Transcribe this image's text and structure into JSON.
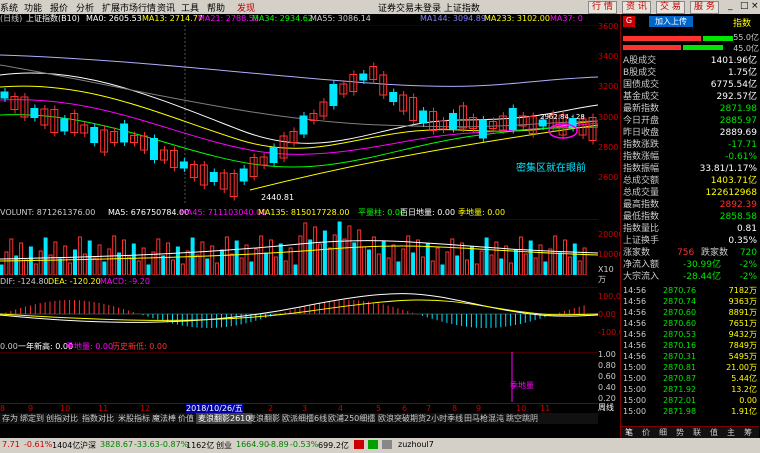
{
  "menu": {
    "items": [
      "系统",
      "功能",
      "报价",
      "分析",
      "扩展市场行情",
      "资讯",
      "工具",
      "帮助"
    ],
    "highlight": "发现",
    "center_title": "证券交易未登录 上证指数",
    "right_buttons": [
      "行 情",
      "资 讯",
      "交 易",
      "服 务"
    ]
  },
  "infobar": {
    "period": "(日线)",
    "index_code": "上证指数(B10)",
    "ma0": "MA0: 2605.53",
    "ma13": "MA13: 2714.77",
    "ma21": "MA21: 2788.53",
    "ma34": "MA34: 2934.62",
    "ma55": "MA55: 3086.14",
    "ma144": "MA144: 3094.89",
    "ma233": "MA233: 3102.00",
    "ma_tail": "MA37: 0"
  },
  "main_axis": [
    "3600",
    "3400",
    "3200",
    "3000",
    "2800",
    "2600"
  ],
  "annotations": {
    "low_value": "2440.81",
    "recent_value": "2962.84 - 28",
    "note": "密集区就在眼前"
  },
  "volume_bar": {
    "volume": "VOLUNT: 871261376.00",
    "ma5": "MA5: 676750784.00",
    "ma45": "MA45: 711103040.00",
    "ma135": "MA135: 815017728.00",
    "flat": "平量柱: 0.00",
    "hundred": "百日地量: 0.00",
    "season": "季地量: 0.00",
    "axis": [
      "20000",
      "10000",
      "X10万"
    ]
  },
  "macd": {
    "dif": "DIF: -124.80",
    "dea": "DEA: -120.20",
    "macd": "MACD: -9.20",
    "axis": [
      "100.0",
      "0.00",
      "-100.0"
    ]
  },
  "indicator": {
    "label1": "0.00",
    "label2": "一年新高: 0.00",
    "label3": "季地量: 0.00",
    "label4": "历史新低: 0.00",
    "axis": [
      "1.00",
      "0.80",
      "0.60",
      "0.40",
      "0.20"
    ],
    "marker": "季地量"
  },
  "xaxis": {
    "date_label": "2018/10/26/五",
    "months": [
      "8",
      "9",
      "10",
      "11",
      "12",
      "2",
      "3",
      "4",
      "5",
      "6",
      "7",
      "8",
      "9",
      "10",
      "11"
    ],
    "right_label": "周线"
  },
  "bottom_tabs": [
    "存为",
    "绑定到",
    "创指对比",
    "指数对比",
    "米股指标",
    "魔法棒",
    "价值",
    "麦浪翻影2610",
    "麦浪翻影",
    "欧派细擂6线",
    "欧浦250细擂",
    "欧浪突破",
    "期货2小时季线",
    "田马枪",
    "混沌",
    "跳空跳阴"
  ],
  "right_panel": {
    "header_label": "指数",
    "header_button": "加入上传",
    "top_values": [
      "55.0亿",
      "45.0亿"
    ],
    "rows": [
      {
        "k": "A股成交",
        "v": "1401.96亿",
        "c": "white"
      },
      {
        "k": "B股成交",
        "v": "1.75亿",
        "c": "white"
      },
      {
        "k": "国债成交",
        "v": "6775.54亿",
        "c": "white"
      },
      {
        "k": "基金成交",
        "v": "292.57亿",
        "c": "white"
      },
      {
        "k": "最新指数",
        "v": "2871.98",
        "c": "green"
      },
      {
        "k": "今日开盘",
        "v": "2885.97",
        "c": "green"
      },
      {
        "k": "昨日收盘",
        "v": "2889.69",
        "c": "white"
      },
      {
        "k": "指数涨跌",
        "v": "-17.71",
        "c": "green"
      },
      {
        "k": "指数涨幅",
        "v": "-0.61%",
        "c": "green"
      },
      {
        "k": "指数振幅",
        "v": "33.81/1.17%",
        "c": "white"
      },
      {
        "k": "总成交额",
        "v": "1403.71亿",
        "c": "yellow"
      },
      {
        "k": "总成交量",
        "v": "122612968",
        "c": "yellow"
      },
      {
        "k": "最高指数",
        "v": "2892.39",
        "c": "red"
      },
      {
        "k": "最低指数",
        "v": "2858.58",
        "c": "green"
      },
      {
        "k": "指数量比",
        "v": "0.81",
        "c": "white"
      },
      {
        "k": "上证换手",
        "v": "0.35%",
        "c": "white"
      }
    ],
    "up_label": "涨家数",
    "up_value": "756",
    "down_label": "跌家数",
    "down_value": "720",
    "inflow_label": "净流入额",
    "inflow_value": "-30.99亿",
    "inflow_pct": "-2%",
    "big_label": "大宗流入",
    "big_value": "-28.44亿",
    "big_pct": "-2%",
    "ticks": [
      {
        "t": "14:56",
        "p": "2870.76",
        "v": "7182万"
      },
      {
        "t": "14:56",
        "p": "2870.74",
        "v": "9363万"
      },
      {
        "t": "14:56",
        "p": "2870.60",
        "v": "8891万"
      },
      {
        "t": "14:56",
        "p": "2870.60",
        "v": "7651万"
      },
      {
        "t": "14:56",
        "p": "2870.53",
        "v": "9432万"
      },
      {
        "t": "14:56",
        "p": "2870.16",
        "v": "7849万"
      },
      {
        "t": "14:56",
        "p": "2870.31",
        "v": "5495万"
      },
      {
        "t": "15:00",
        "p": "2870.81",
        "v": "21.00万"
      },
      {
        "t": "15:00",
        "p": "2870.87",
        "v": "5.44亿"
      },
      {
        "t": "15:00",
        "p": "2871.92",
        "v": "13.2亿"
      },
      {
        "t": "15:00",
        "p": "2872.01",
        "v": "0.00"
      },
      {
        "t": "15:00",
        "p": "2871.98",
        "v": "1.91亿"
      }
    ],
    "bottom_tabs": [
      "笔",
      "价",
      "细",
      "势",
      "联",
      "值",
      "主",
      "筹"
    ]
  },
  "status": {
    "sh_value": "7.71",
    "sh_pct": "-0.61%",
    "sh_amount": "1404亿",
    "sz_label": "沪深",
    "sz_value": "3828.67",
    "sz_change": "-33.63",
    "sz_pct": "-0.87%",
    "sz_amount": "1162亿",
    "cy_label": "创业",
    "cy_value": "1664.90",
    "cy_change": "-8.89",
    "cy_pct": "-0.53%",
    "cy_amount": "699.2亿",
    "user": "zuzhoul7"
  },
  "colors": {
    "up": "#ff3232",
    "down": "#00e6ff",
    "panel_border": "#800000",
    "accent": "#ffff00"
  }
}
